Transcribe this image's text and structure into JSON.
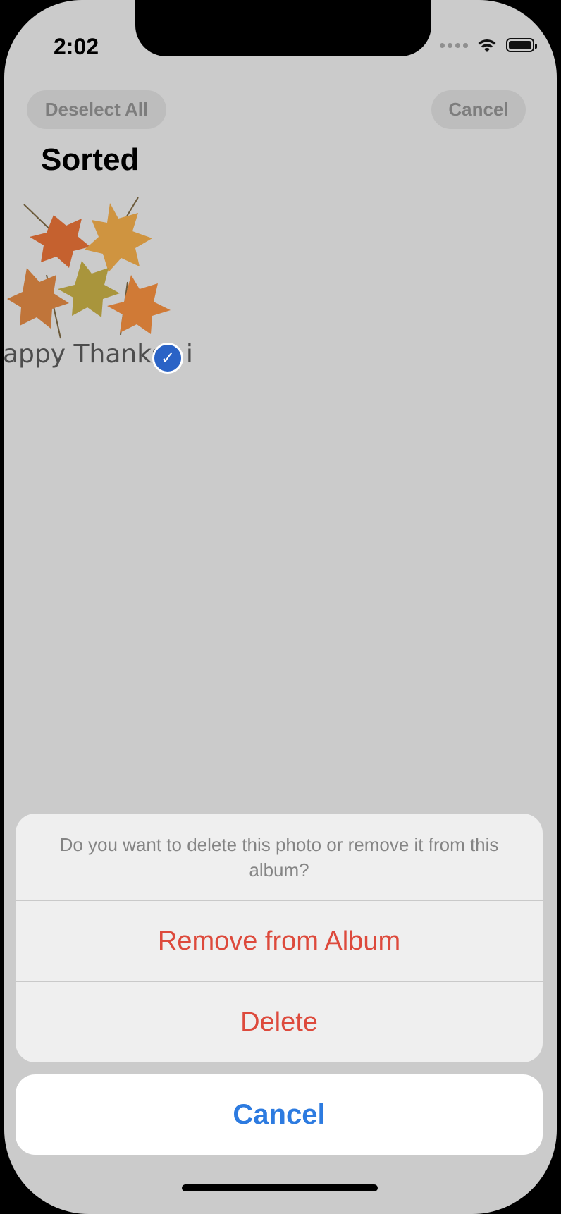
{
  "status_bar": {
    "time": "2:02"
  },
  "nav": {
    "deselect_all": "Deselect All",
    "cancel": "Cancel"
  },
  "album": {
    "title": "Sorted"
  },
  "item": {
    "thumb_text": "appy Thanks",
    "thumb_text_tail": "i",
    "selected": true
  },
  "action_sheet": {
    "message": "Do you want to delete this photo or remove it from this album?",
    "remove_label": "Remove from Album",
    "delete_label": "Delete",
    "cancel_label": "Cancel"
  },
  "colors": {
    "destructive": "#dd4a3c",
    "accent": "#2d7be0",
    "selection": "#2a63c6"
  }
}
